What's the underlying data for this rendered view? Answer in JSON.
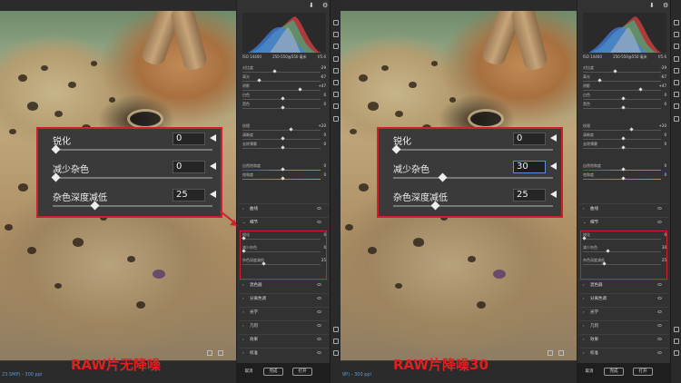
{
  "accent": "#d01f2a",
  "panes": [
    {
      "zoom": "23.5MP) - 300 ppi",
      "camera": {
        "iso": "ISO 14400",
        "lens": "250-550@550 毫米",
        "aperture": "f/5.6"
      },
      "params": [
        {
          "label": "对比度",
          "value": "-29",
          "pos": 0.4
        },
        {
          "label": "高光",
          "value": "-67",
          "pos": 0.2
        },
        {
          "label": "阴影",
          "value": "+47",
          "pos": 0.72
        },
        {
          "label": "白色",
          "value": "0",
          "pos": 0.5
        },
        {
          "label": "黑色",
          "value": "0",
          "pos": 0.5
        },
        {
          "label": "纹理",
          "value": "+20",
          "pos": 0.6
        },
        {
          "label": "清晰度",
          "value": "0",
          "pos": 0.5
        },
        {
          "label": "去除薄雾",
          "value": "0",
          "pos": 0.5
        },
        {
          "label": "自然饱和度",
          "value": "0",
          "pos": 0.5,
          "style": "warm"
        },
        {
          "label": "饱和度",
          "value": "0",
          "pos": 0.5,
          "style": "sat"
        }
      ],
      "sections_top": [
        {
          "title": "曲线",
          "chev": "›"
        },
        {
          "title": "细节",
          "chev": "⌄"
        }
      ],
      "detail": [
        {
          "label": "锐化",
          "value": "0",
          "pos": 0.0
        },
        {
          "label": "减少杂色",
          "value": "0",
          "pos": 0.0
        },
        {
          "label": "杂色深度减低",
          "value": "25",
          "pos": 0.25
        }
      ],
      "sections_bottom": [
        {
          "title": "混色器",
          "chev": "›"
        },
        {
          "title": "分离色调",
          "chev": "›"
        },
        {
          "title": "光学",
          "chev": "›"
        },
        {
          "title": "几何",
          "chev": "›"
        },
        {
          "title": "效果",
          "chev": "›"
        },
        {
          "title": "校准",
          "chev": "›"
        }
      ],
      "callout": [
        {
          "label": "锐化",
          "value": "0",
          "pos": 0.0,
          "active": false
        },
        {
          "label": "减少杂色",
          "value": "0",
          "pos": 0.0,
          "active": false
        },
        {
          "label": "杂色深度减低",
          "value": "25",
          "pos": 0.25,
          "active": false
        }
      ],
      "buttons": {
        "cancel": "取消",
        "done": "完成",
        "open": "打开"
      },
      "caption": "RAW片无降噪"
    },
    {
      "zoom": "9P) - 300 ppi",
      "camera": {
        "iso": "ISO 14400",
        "lens": "250-550@550 毫米",
        "aperture": "f/5.6"
      },
      "params": [
        {
          "label": "对比度",
          "value": "-29",
          "pos": 0.4
        },
        {
          "label": "高光",
          "value": "-67",
          "pos": 0.2
        },
        {
          "label": "阴影",
          "value": "+47",
          "pos": 0.72
        },
        {
          "label": "白色",
          "value": "0",
          "pos": 0.5
        },
        {
          "label": "黑色",
          "value": "0",
          "pos": 0.5
        },
        {
          "label": "纹理",
          "value": "+20",
          "pos": 0.6
        },
        {
          "label": "清晰度",
          "value": "0",
          "pos": 0.5
        },
        {
          "label": "去除薄雾",
          "value": "0",
          "pos": 0.5
        },
        {
          "label": "自然饱和度",
          "value": "0",
          "pos": 0.5,
          "style": "warm"
        },
        {
          "label": "饱和度",
          "value": "0",
          "pos": 0.5,
          "style": "sat"
        }
      ],
      "sections_top": [
        {
          "title": "曲线",
          "chev": "›"
        },
        {
          "title": "细节",
          "chev": "⌄"
        }
      ],
      "detail": [
        {
          "label": "锐化",
          "value": "0",
          "pos": 0.0
        },
        {
          "label": "减少杂色",
          "value": "30",
          "pos": 0.3
        },
        {
          "label": "杂色深度减低",
          "value": "25",
          "pos": 0.25
        }
      ],
      "sections_bottom": [
        {
          "title": "混色器",
          "chev": "›"
        },
        {
          "title": "分离色调",
          "chev": "›"
        },
        {
          "title": "光学",
          "chev": "›"
        },
        {
          "title": "几何",
          "chev": "›"
        },
        {
          "title": "效果",
          "chev": "›"
        },
        {
          "title": "校准",
          "chev": "›"
        }
      ],
      "callout": [
        {
          "label": "锐化",
          "value": "0",
          "pos": 0.0,
          "active": false
        },
        {
          "label": "减少杂色",
          "value": "30",
          "pos": 0.3,
          "active": true
        },
        {
          "label": "杂色深度减低",
          "value": "25",
          "pos": 0.25,
          "active": false
        }
      ],
      "buttons": {
        "cancel": "取消",
        "done": "完成",
        "open": "打开"
      },
      "caption": "RAW片降噪30"
    }
  ]
}
